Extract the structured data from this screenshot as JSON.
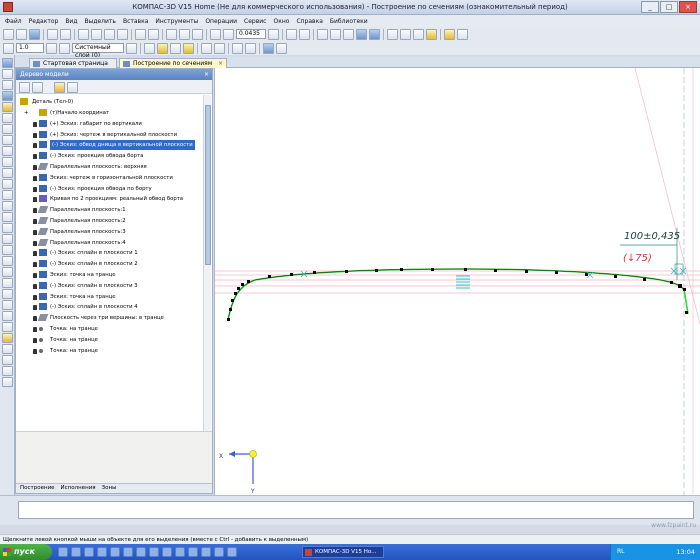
{
  "window": {
    "title": "КОМПАС-3D V15 Home (Не для коммерческого использования) - Построение по сечениям (ознакомительный период)"
  },
  "menu": [
    "Файл",
    "Редактор",
    "Вид",
    "Выделить",
    "Вставка",
    "Инструменты",
    "Операции",
    "Сервис",
    "Окно",
    "Справка",
    "Библиотеки"
  ],
  "toolbar": {
    "zoom_value": "0.0435",
    "scale_value": "1.0",
    "layer_value": "Системный слой (0)"
  },
  "tabs": [
    {
      "label": "Стартовая страница"
    },
    {
      "label": "Построение по сечениям"
    }
  ],
  "tree": {
    "title": "Дерево модели",
    "root": "Деталь (Тел-0)",
    "items": [
      {
        "label": "(т)Начало координат",
        "icon": "origin-icon"
      },
      {
        "label": "(+) Эскиз: габарит по вертикали",
        "icon": "sketch-icon"
      },
      {
        "label": "(+) Эскиз: чертеж в вертикальной плоскости",
        "icon": "sketch-icon"
      },
      {
        "label": "(-) Эскиз: обвод днища в вертикальной плоскости",
        "icon": "sketch-icon"
      },
      {
        "label": "(-) Эскиз: проекция обвода борта",
        "icon": "sketch-icon"
      },
      {
        "label": "Параллельная плоскость: верхняя",
        "icon": "plane-icon"
      },
      {
        "label": "Эскиз: чертеж в горизонтальной плоскости",
        "icon": "sketch-icon"
      },
      {
        "label": "(-) Эскиз: проекция обвода по борту",
        "icon": "sketch-icon"
      },
      {
        "label": "Кривая по 2 проекциям: реальный обвод борта",
        "icon": "curve-icon"
      },
      {
        "label": "Параллельная плоскость:1",
        "icon": "plane-icon"
      },
      {
        "label": "Параллельная плоскость:2",
        "icon": "plane-icon"
      },
      {
        "label": "Параллельная плоскость:3",
        "icon": "plane-icon"
      },
      {
        "label": "Параллельная плоскость:4",
        "icon": "plane-icon"
      },
      {
        "label": "(-) Эскиз: сплайн в плоскости 1",
        "icon": "sketch-icon"
      },
      {
        "label": "(-) Эскиз: сплайн в плоскости 2",
        "icon": "sketch-icon"
      },
      {
        "label": "Эскиз: точка на транце",
        "icon": "sketch-icon"
      },
      {
        "label": "(-) Эскиз: сплайн в плоскости 3",
        "icon": "sketch-icon"
      },
      {
        "label": "Эскиз: точка на транце",
        "icon": "sketch-icon"
      },
      {
        "label": "(-) Эскиз: сплайн в плоскости 4",
        "icon": "sketch-icon"
      },
      {
        "label": "Плоскость через три вершины: в транце",
        "icon": "plane-icon"
      },
      {
        "label": "Точка: на транце",
        "icon": "point-icon"
      },
      {
        "label": "Точка: на транце",
        "icon": "point-icon"
      },
      {
        "label": "Точка: на транце",
        "icon": "point-icon"
      }
    ],
    "selected_index": 3,
    "bottom_tabs": [
      "Построение",
      "Исполнения",
      "Зоны"
    ]
  },
  "canvas": {
    "dim_tolerance": "100±0,435",
    "dim_reference": "(↓75)",
    "axis_x": "X",
    "axis_y": "Y"
  },
  "status": {
    "hint": "Щелкните левой кнопкой мыши на объекте для его выделения (вместе с Ctrl - добавить к выделенным)"
  },
  "taskbar": {
    "start_label": "пуск",
    "task_label": "КОМПАС-3D V15 Ho...",
    "lang": "RL",
    "time": "13:04"
  },
  "watermark": "www.fzpaint.ru",
  "colors": {
    "curve": "#37d43a",
    "selection": "#3268c8",
    "dim_red": "#d33"
  }
}
